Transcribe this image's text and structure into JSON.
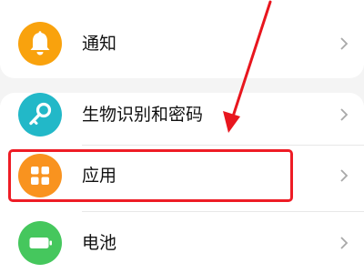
{
  "settings": {
    "items": [
      {
        "label": "通知",
        "icon": "bell-icon",
        "color": "#f9a20d"
      },
      {
        "label": "生物识别和密码",
        "icon": "key-icon",
        "color": "#22b8c8"
      },
      {
        "label": "应用",
        "icon": "apps-grid-icon",
        "color": "#f9931f"
      },
      {
        "label": "电池",
        "icon": "battery-icon",
        "color": "#45c75d"
      }
    ]
  },
  "annotation": {
    "highlight_color": "#ee1c25",
    "arrow_color": "#e8161e"
  }
}
